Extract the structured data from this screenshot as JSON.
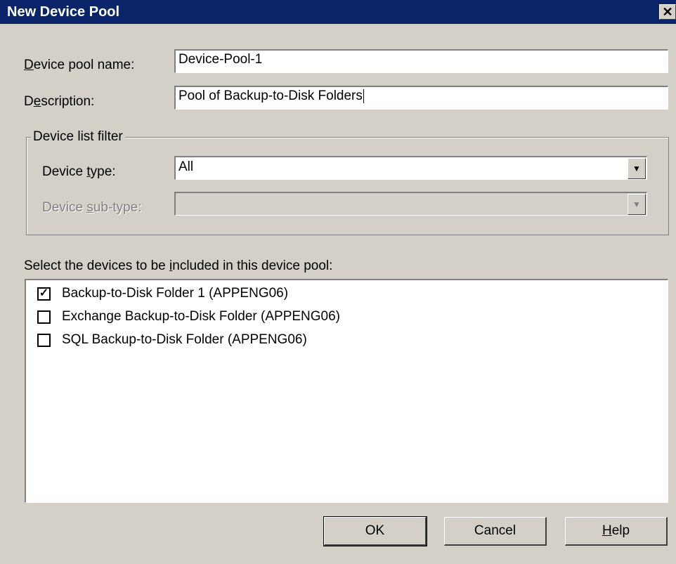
{
  "window": {
    "title": "New Device Pool",
    "close_glyph": "✕"
  },
  "form": {
    "pool_name_label_pre": "",
    "pool_name_label_key": "D",
    "pool_name_label_post": "evice pool name:",
    "pool_name_value": "Device-Pool-1",
    "description_label_pre": "D",
    "description_label_key": "e",
    "description_label_post": "scription:",
    "description_value": "Pool of Backup-to-Disk Folders"
  },
  "filter": {
    "legend": "Device list filter",
    "type_label_pre": "Device ",
    "type_label_key": "t",
    "type_label_post": "ype:",
    "type_value": "All",
    "subtype_label_pre": "Device ",
    "subtype_label_key": "s",
    "subtype_label_post": "ub-type:",
    "subtype_value": ""
  },
  "devices": {
    "prompt_pre": "Select the devices to be ",
    "prompt_key": "i",
    "prompt_post": "ncluded in this device pool:",
    "items": [
      {
        "label": "Backup-to-Disk Folder 1 (APPENG06)",
        "checked": true,
        "mark": "✓"
      },
      {
        "label": "Exchange Backup-to-Disk Folder (APPENG06)",
        "checked": false,
        "mark": ""
      },
      {
        "label": "SQL Backup-to-Disk Folder (APPENG06)",
        "checked": false,
        "mark": ""
      }
    ]
  },
  "buttons": {
    "ok": "OK",
    "cancel": "Cancel",
    "help_key": "H",
    "help_post": "elp"
  },
  "icons": {
    "dropdown_arrow": "▼",
    "close": "close-icon",
    "checkmark": "checkmark-icon"
  }
}
